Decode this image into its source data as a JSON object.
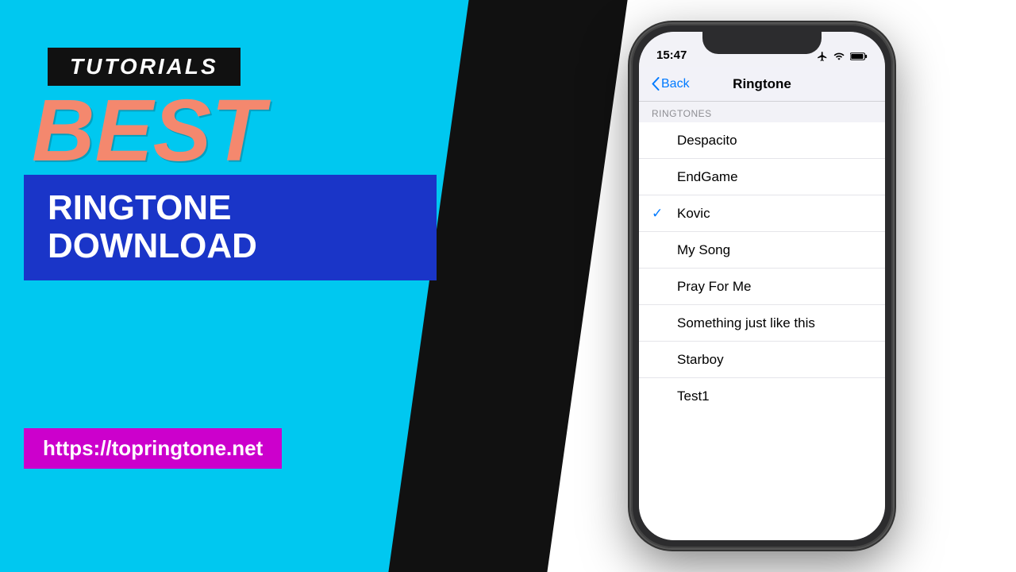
{
  "left": {
    "tutorials_label": "TUTORIALS",
    "best_label": "BEST",
    "ringtone_line1": "RINGTONE DOWNLOAD",
    "url": "https://topringtone.net",
    "bg_color": "#00c8f0"
  },
  "right": {
    "iphone": {
      "status": {
        "time": "15:47"
      },
      "nav": {
        "back_label": "Back",
        "title": "Ringtone"
      },
      "section_header": "RINGTONES",
      "ringtones": [
        {
          "name": "Despacito",
          "selected": false
        },
        {
          "name": "EndGame",
          "selected": false
        },
        {
          "name": "Kovic",
          "selected": true
        },
        {
          "name": "My Song",
          "selected": false
        },
        {
          "name": "Pray For Me",
          "selected": false
        },
        {
          "name": "Something just like this",
          "selected": false
        },
        {
          "name": "Starboy",
          "selected": false
        },
        {
          "name": "Test1",
          "selected": false
        }
      ]
    }
  }
}
